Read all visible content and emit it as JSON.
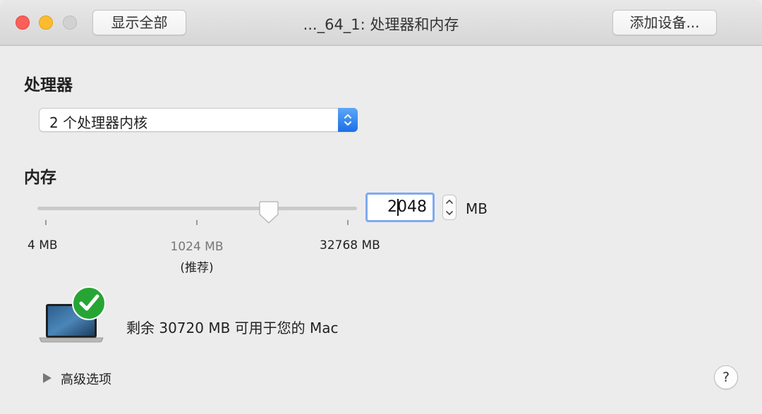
{
  "window": {
    "title": "..._64_1: 处理器和内存",
    "show_all_label": "显示全部",
    "add_device_label": "添加设备..."
  },
  "processor": {
    "heading": "处理器",
    "selected": "2 个处理器内核"
  },
  "memory": {
    "heading": "内存",
    "value": "2048",
    "unit": "MB",
    "tick_min": "4 MB",
    "tick_recommended": "1024 MB",
    "tick_recommended_note": "(推荐)",
    "tick_max": "32768 MB",
    "slider_min": 4,
    "slider_max": 32768,
    "slider_value": 2048
  },
  "status": {
    "text": "剩余 30720 MB 可用于您的 Mac",
    "icon": "laptop-check-icon",
    "check_color": "#27a534"
  },
  "advanced": {
    "label": "高级选项"
  },
  "help": {
    "label": "?"
  },
  "colors": {
    "accent": "#1b6fe7",
    "focus_ring": "#7eaaf0"
  }
}
